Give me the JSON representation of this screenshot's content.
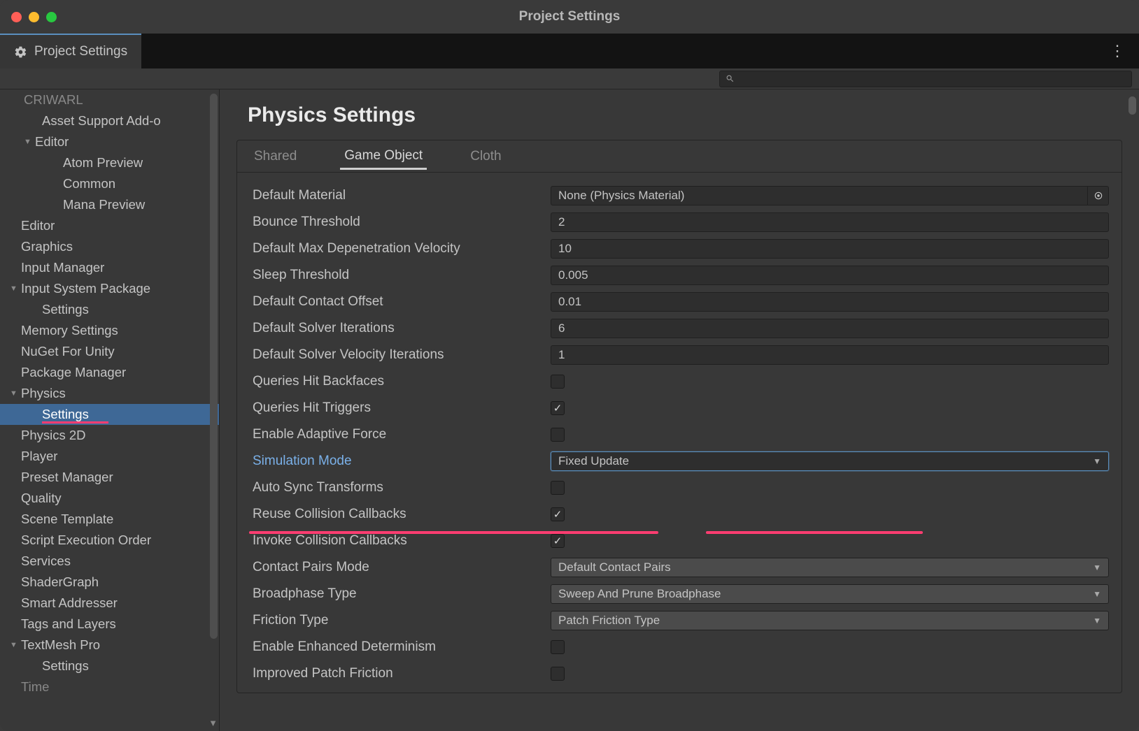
{
  "window": {
    "title": "Project Settings"
  },
  "tab": {
    "label": "Project Settings"
  },
  "search": {
    "placeholder": ""
  },
  "sidebar": {
    "items": [
      {
        "label": "CRIWARL",
        "depth": 1,
        "exp": "",
        "truncated": true
      },
      {
        "label": "Asset Support Add-o",
        "depth": 2,
        "exp": ""
      },
      {
        "label": "Editor",
        "depth": 1,
        "exp": "▼"
      },
      {
        "label": "Atom Preview",
        "depth": 3,
        "exp": ""
      },
      {
        "label": "Common",
        "depth": 3,
        "exp": ""
      },
      {
        "label": "Mana Preview",
        "depth": 3,
        "exp": ""
      },
      {
        "label": "Editor",
        "depth": 0,
        "exp": ""
      },
      {
        "label": "Graphics",
        "depth": 0,
        "exp": ""
      },
      {
        "label": "Input Manager",
        "depth": 0,
        "exp": ""
      },
      {
        "label": "Input System Package",
        "depth": 0,
        "exp": "▼"
      },
      {
        "label": "Settings",
        "depth": 2,
        "exp": ""
      },
      {
        "label": "Memory Settings",
        "depth": 0,
        "exp": ""
      },
      {
        "label": "NuGet For Unity",
        "depth": 0,
        "exp": ""
      },
      {
        "label": "Package Manager",
        "depth": 0,
        "exp": ""
      },
      {
        "label": "Physics",
        "depth": 0,
        "exp": "▼"
      },
      {
        "label": "Settings",
        "depth": 2,
        "exp": "",
        "selected": true
      },
      {
        "label": "Physics 2D",
        "depth": 0,
        "exp": ""
      },
      {
        "label": "Player",
        "depth": 0,
        "exp": ""
      },
      {
        "label": "Preset Manager",
        "depth": 0,
        "exp": ""
      },
      {
        "label": "Quality",
        "depth": 0,
        "exp": ""
      },
      {
        "label": "Scene Template",
        "depth": 0,
        "exp": ""
      },
      {
        "label": "Script Execution Order",
        "depth": 0,
        "exp": ""
      },
      {
        "label": "Services",
        "depth": 0,
        "exp": ""
      },
      {
        "label": "ShaderGraph",
        "depth": 0,
        "exp": ""
      },
      {
        "label": "Smart Addresser",
        "depth": 0,
        "exp": ""
      },
      {
        "label": "Tags and Layers",
        "depth": 0,
        "exp": ""
      },
      {
        "label": "TextMesh Pro",
        "depth": 0,
        "exp": "▼"
      },
      {
        "label": "Settings",
        "depth": 2,
        "exp": ""
      },
      {
        "label": "Time",
        "depth": 0,
        "exp": "",
        "truncated": true
      }
    ]
  },
  "main": {
    "title": "Physics Settings",
    "tabs": [
      {
        "label": "Shared",
        "active": false
      },
      {
        "label": "Game Object",
        "active": true
      },
      {
        "label": "Cloth",
        "active": false
      }
    ],
    "fields": [
      {
        "label": "Default Material",
        "type": "object",
        "value": "None (Physics Material)"
      },
      {
        "label": "Bounce Threshold",
        "type": "text",
        "value": "2"
      },
      {
        "label": "Default Max Depenetration Velocity",
        "type": "text",
        "value": "10"
      },
      {
        "label": "Sleep Threshold",
        "type": "text",
        "value": "0.005"
      },
      {
        "label": "Default Contact Offset",
        "type": "text",
        "value": "0.01"
      },
      {
        "label": "Default Solver Iterations",
        "type": "text",
        "value": "6"
      },
      {
        "label": "Default Solver Velocity Iterations",
        "type": "text",
        "value": "1"
      },
      {
        "label": "Queries Hit Backfaces",
        "type": "checkbox",
        "value": false
      },
      {
        "label": "Queries Hit Triggers",
        "type": "checkbox",
        "value": true
      },
      {
        "label": "Enable Adaptive Force",
        "type": "checkbox",
        "value": false
      },
      {
        "label": "Simulation Mode",
        "type": "dropdown",
        "value": "Fixed Update",
        "highlighted": true
      },
      {
        "label": "Auto Sync Transforms",
        "type": "checkbox",
        "value": false
      },
      {
        "label": "Reuse Collision Callbacks",
        "type": "checkbox",
        "value": true
      },
      {
        "label": "Invoke Collision Callbacks",
        "type": "checkbox",
        "value": true
      },
      {
        "label": "Contact Pairs Mode",
        "type": "dropdown",
        "value": "Default Contact Pairs",
        "bright": true
      },
      {
        "label": "Broadphase Type",
        "type": "dropdown",
        "value": "Sweep And Prune Broadphase",
        "bright": true
      },
      {
        "label": "Friction Type",
        "type": "dropdown",
        "value": "Patch Friction Type",
        "bright": true
      },
      {
        "label": "Enable Enhanced Determinism",
        "type": "checkbox",
        "value": false
      },
      {
        "label": "Improved Patch Friction",
        "type": "checkbox",
        "value": false
      }
    ]
  }
}
